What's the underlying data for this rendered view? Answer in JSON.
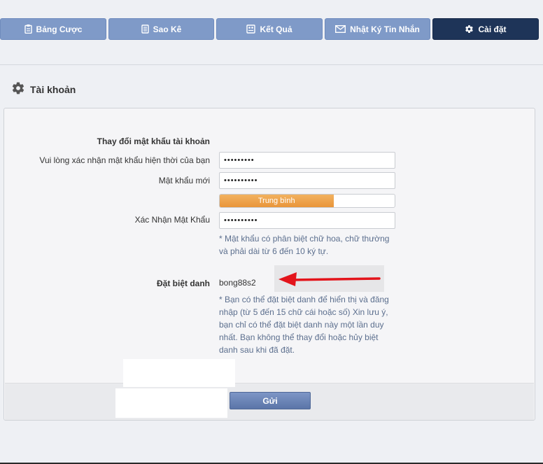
{
  "tabs": [
    {
      "label": "Bảng Cược",
      "icon": "clipboard-icon"
    },
    {
      "label": "Sao Kê",
      "icon": "ledger-icon"
    },
    {
      "label": "Kết Quả",
      "icon": "results-icon"
    },
    {
      "label": "Nhật Ký Tin Nhắn",
      "icon": "envelope-icon"
    },
    {
      "label": "Cài đặt",
      "icon": "gear-icon",
      "active": true
    }
  ],
  "section": {
    "title": "Tài khoản",
    "icon": "gear-icon"
  },
  "password": {
    "heading": "Thay đổi mật khẩu tài khoản",
    "current_label": "Vui lòng xác nhận mật khẩu hiện thời của bạn",
    "current_value": "•••••••••",
    "new_label": "Mật khẩu mới",
    "new_value": "••••••••••",
    "strength_label": "Trung bình",
    "strength_level": 0.65,
    "confirm_label": "Xác Nhận Mật Khẩu",
    "confirm_value": "••••••••••",
    "note": "* Mật khẩu có phân biệt chữ hoa, chữ thường và phải dài từ 6 đến 10 ký tự."
  },
  "nickname": {
    "label": "Đặt biệt danh",
    "value": "bong88s2",
    "note": "* Bạn có thể đặt biệt danh để hiển thị và đăng nhập (từ 5 đến 15 chữ cái hoặc số) Xin lưu ý, bạn chỉ có thể đặt biệt danh này một lần duy nhất. Bạn không thể thay đổi hoặc hủy biệt danh sau khi đã đặt."
  },
  "submit_label": "Gửi",
  "colors": {
    "tab": "#7f9ac8",
    "tab_active": "#1e3458",
    "strength": "#ec9e45",
    "note_text": "#5c6f8e",
    "arrow": "#e3141b"
  }
}
